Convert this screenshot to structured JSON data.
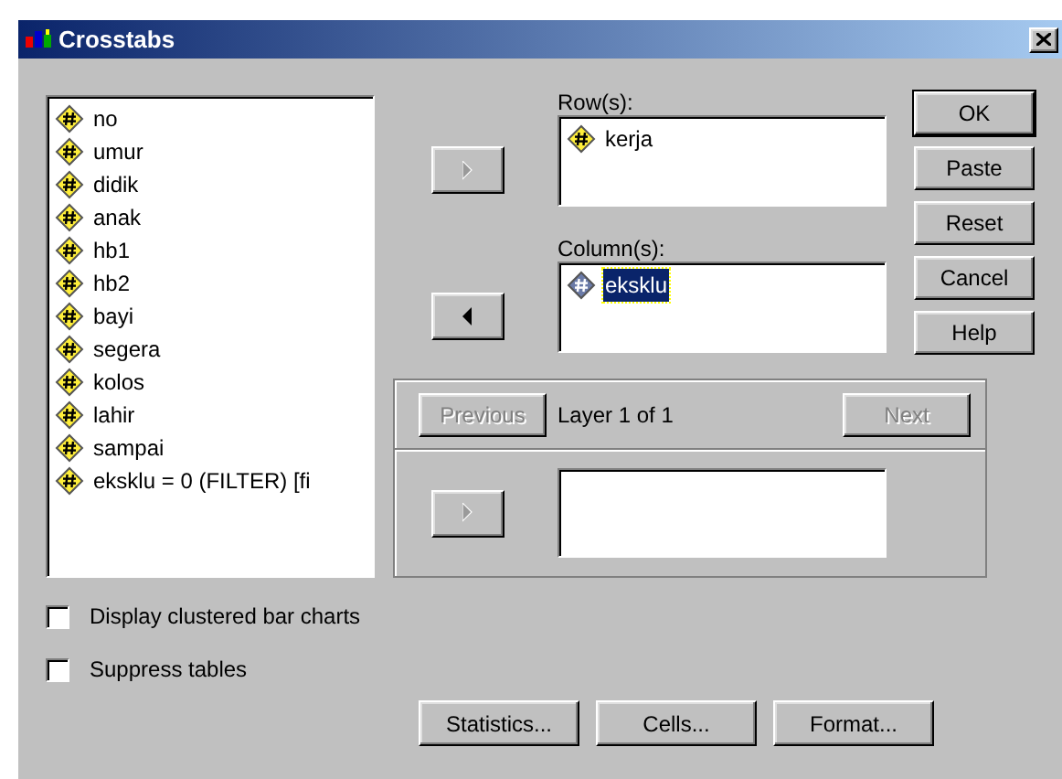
{
  "window": {
    "title": "Crosstabs"
  },
  "variables": [
    {
      "name": "no",
      "selected": false
    },
    {
      "name": "umur",
      "selected": false
    },
    {
      "name": "didik",
      "selected": false
    },
    {
      "name": "anak",
      "selected": false
    },
    {
      "name": "hb1",
      "selected": false
    },
    {
      "name": "hb2",
      "selected": false
    },
    {
      "name": "bayi",
      "selected": false
    },
    {
      "name": "segera",
      "selected": false
    },
    {
      "name": "kolos",
      "selected": false
    },
    {
      "name": "lahir",
      "selected": false
    },
    {
      "name": "sampai",
      "selected": false
    },
    {
      "name": "eksklu = 0 (FILTER) [fi",
      "selected": false
    }
  ],
  "move_buttons": [
    {
      "kind": "right",
      "disabled": true
    },
    {
      "kind": "left",
      "disabled": false
    }
  ],
  "rows_box": {
    "label": "Row(s):",
    "items": [
      {
        "name": "kerja",
        "selected": false
      }
    ]
  },
  "columns_box": {
    "label": "Column(s):",
    "items": [
      {
        "name": "eksklu",
        "selected": true
      }
    ]
  },
  "side_buttons": [
    {
      "label": "OK",
      "default": true
    },
    {
      "label": "Paste",
      "default": false
    },
    {
      "label": "Reset",
      "default": false
    },
    {
      "label": "Cancel",
      "default": false
    },
    {
      "label": "Help",
      "default": false
    }
  ],
  "layer": {
    "previous": {
      "label": "Previous",
      "disabled": true
    },
    "caption": "Layer 1 of 1",
    "next": {
      "label": "Next",
      "disabled": true
    },
    "move_button": {
      "kind": "right",
      "disabled": true
    }
  },
  "options": [
    {
      "label": "Display clustered bar charts",
      "checked": false
    },
    {
      "label": "Suppress tables",
      "checked": false
    }
  ],
  "bottom_buttons": [
    {
      "label": "Statistics..."
    },
    {
      "label": "Cells..."
    },
    {
      "label": "Format..."
    }
  ]
}
